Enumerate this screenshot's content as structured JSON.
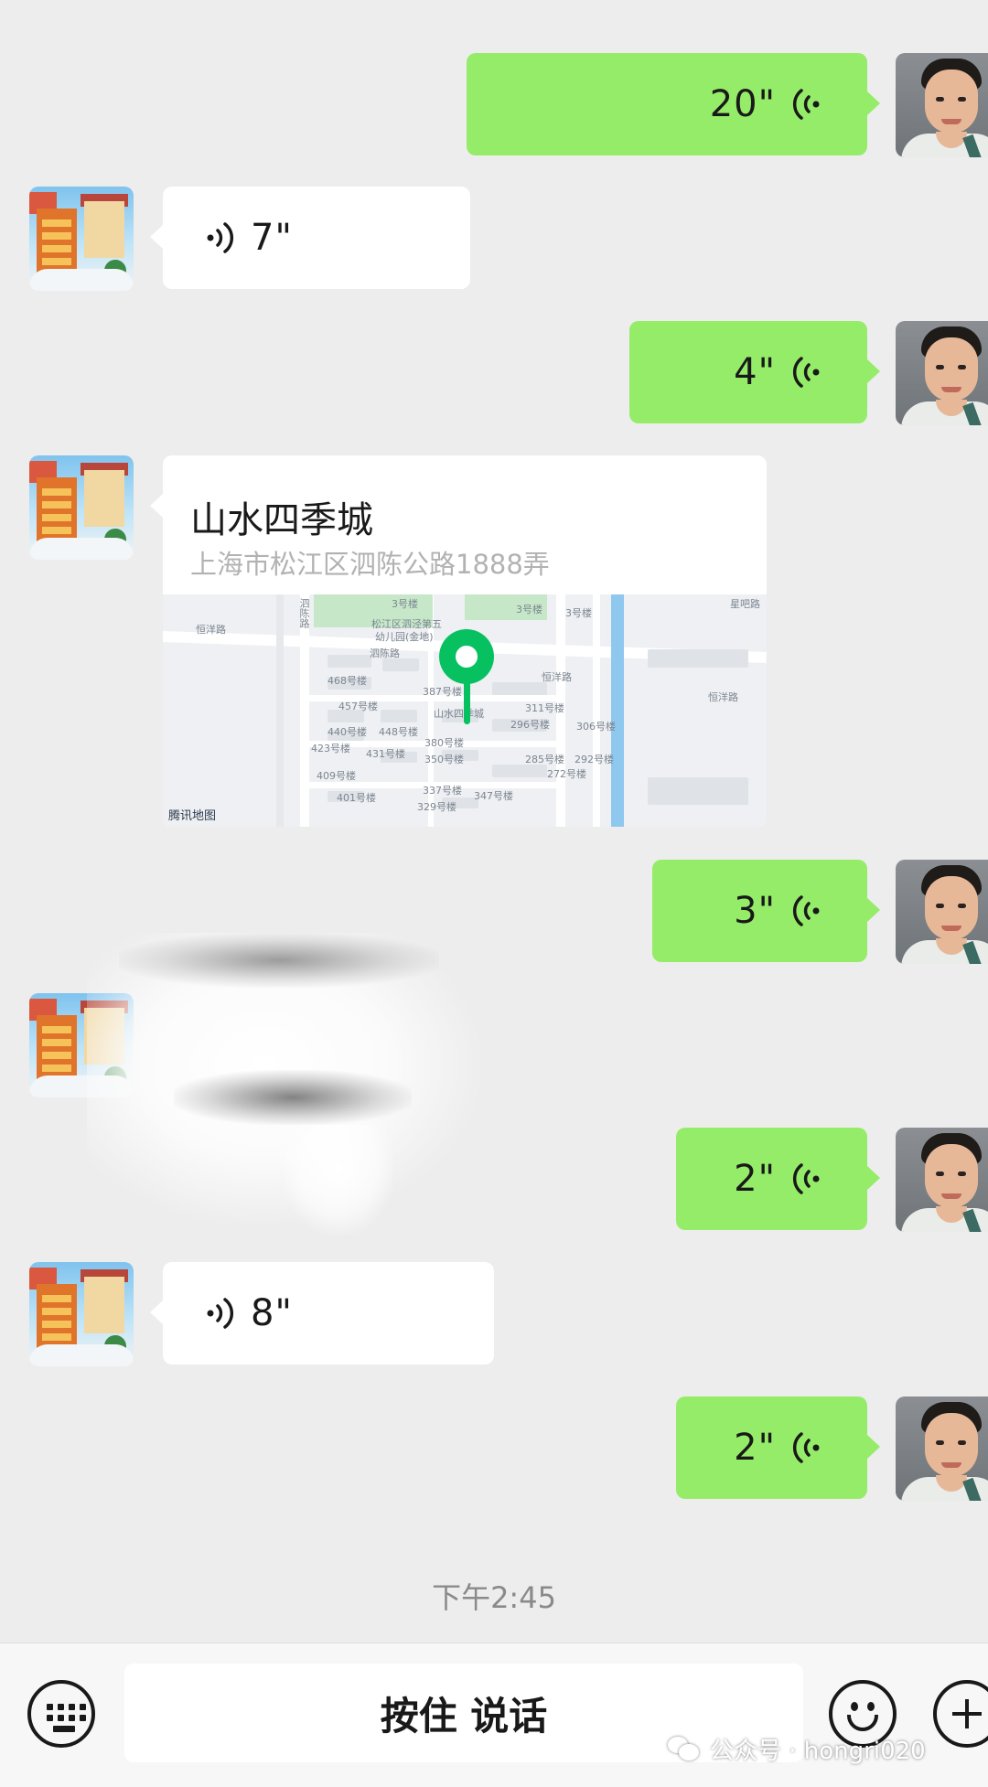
{
  "chat": {
    "messages": [
      {
        "side": "me",
        "type": "voice",
        "duration": "20\""
      },
      {
        "side": "them",
        "type": "voice",
        "duration": "7\""
      },
      {
        "side": "me",
        "type": "voice",
        "duration": "4\""
      },
      {
        "side": "them",
        "type": "location",
        "title": "山水四季城",
        "address": "上海市松江区泗陈公路1888弄"
      },
      {
        "side": "me",
        "type": "voice",
        "duration": "3\""
      },
      {
        "side": "them",
        "type": "image"
      },
      {
        "side": "me",
        "type": "voice",
        "duration": "2\""
      },
      {
        "side": "them",
        "type": "voice",
        "duration": "8\""
      },
      {
        "side": "me",
        "type": "voice",
        "duration": "2\""
      }
    ],
    "timestamp": "下午2:45"
  },
  "map": {
    "brand": "腾讯地图",
    "labels": {
      "road_left": "恒洋路",
      "road_right": "恒洋路",
      "road_right2": "恒洋路",
      "road_mid": "泗陈路",
      "road_vertical": "泗陈路",
      "kindergarten1": "松江区泗泾第五",
      "kindergarten2": "幼儿园(金地)",
      "community": "山水四季城",
      "b468": "468号楼",
      "b387": "387号楼",
      "b457": "457号楼",
      "b440": "440号楼",
      "b448": "448号楼",
      "b423": "423号楼",
      "b431": "431号楼",
      "b380": "380号楼",
      "b350": "350号楼",
      "b409": "409号楼",
      "b401": "401号楼",
      "b337": "337号楼",
      "b347": "347号楼",
      "b329": "329号楼",
      "b311": "311号楼",
      "b296": "296号楼",
      "b306": "306号楼",
      "b285": "285号楼",
      "b292": "292号楼",
      "b272": "272号楼",
      "b3a": "3号楼",
      "b3b": "3号楼",
      "b3c": "3号楼",
      "top_right": "星吧路"
    }
  },
  "input_bar": {
    "hold_to_talk": "按住 说话"
  },
  "watermark": {
    "text": "公众号 · hongri020"
  },
  "colors": {
    "my_bubble": "#95ec69",
    "their_bubble": "#ffffff",
    "background": "#ededed",
    "pin": "#07c160"
  }
}
